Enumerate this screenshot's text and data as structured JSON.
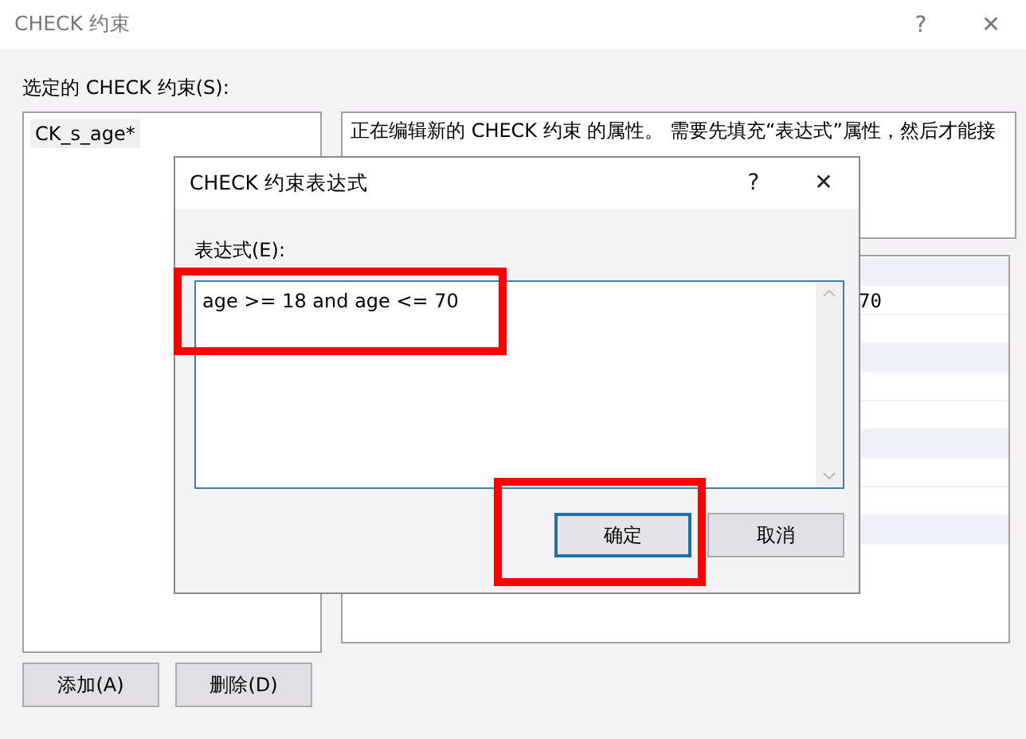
{
  "window": {
    "title": "CHECK 约束",
    "help": "?",
    "close": "✕"
  },
  "constraints_label": "选定的 CHECK 约束(S):",
  "constraints": [
    {
      "name": "CK_s_age*",
      "selected": true
    }
  ],
  "description": "正在编辑新的 CHECK 约束 的属性。 需要先填充“表达式”属性，然后才能接",
  "property_grid": {
    "visible_value": "70"
  },
  "buttons": [
    {
      "label": "添加(A)"
    },
    {
      "label": "删除(D)"
    }
  ],
  "dialog": {
    "title": "CHECK 约束表达式",
    "help": "?",
    "close": "✕",
    "field_label": "表达式(E):",
    "expression": {
      "value": "age >= 18 and age <= 70",
      "highlighted": true
    },
    "buttons": [
      {
        "label": "确定",
        "default": true,
        "highlighted": true
      },
      {
        "label": "取消",
        "default": false,
        "highlighted": false
      }
    ]
  }
}
